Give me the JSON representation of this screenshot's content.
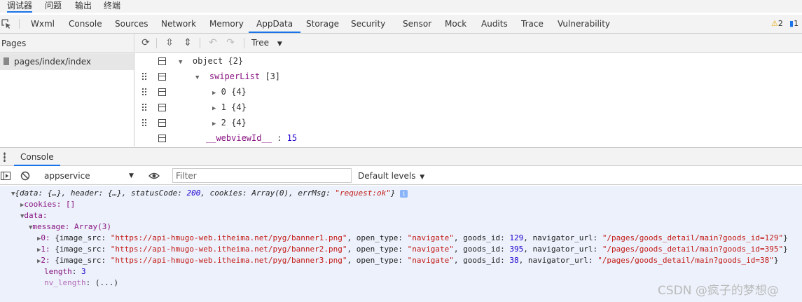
{
  "menubar": {
    "items": [
      {
        "label": "调试器",
        "active": true
      },
      {
        "label": "问题",
        "active": false
      },
      {
        "label": "输出",
        "active": false
      },
      {
        "label": "终端",
        "active": false
      }
    ]
  },
  "tabs": {
    "items": [
      "Wxml",
      "Console",
      "Sources",
      "Network",
      "Memory",
      "AppData",
      "Storage",
      "Security",
      "Sensor",
      "Mock",
      "Audits",
      "Trace",
      "Vulnerability"
    ],
    "active": "AppData",
    "warnings": "2",
    "infos": "1"
  },
  "pages": {
    "title": "Pages",
    "items": [
      "pages/index/index"
    ]
  },
  "appdata": {
    "view_mode": "Tree",
    "tree": [
      {
        "label": "object",
        "meta": "{2}"
      },
      {
        "label": "swiperList",
        "meta": "[3]"
      },
      {
        "label": "0",
        "meta": "{4}"
      },
      {
        "label": "1",
        "meta": "{4}"
      },
      {
        "label": "2",
        "meta": "{4}"
      },
      {
        "label": "__webviewId__",
        "meta": "15"
      }
    ]
  },
  "console": {
    "tab_label": "Console",
    "context": "appservice",
    "filter_placeholder": "Filter",
    "levels": "Default levels",
    "lines": {
      "l0a": "{data: {…}, header: {…}, statusCode: ",
      "l0b": "200",
      "l0c": ", cookies: Array(0), errMsg: ",
      "l0d": "\"request:ok\"",
      "l0e": "}",
      "l1": "cookies: []",
      "l2": "data:",
      "l3": "message: Array(3)",
      "m0_idx": "0:",
      "m0_a": " {image_src: ",
      "m0_src": "\"https://api-hmugo-web.itheima.net/pyg/banner1.png\"",
      "m0_b": ", open_type: ",
      "m0_type": "\"navigate\"",
      "m0_c": ", goods_id: ",
      "m0_id": "129",
      "m0_d": ", navigator_url: ",
      "m0_url": "\"/pages/goods_detail/main?goods_id=129\"",
      "m0_e": "}",
      "m1_idx": "1:",
      "m1_src": "\"https://api-hmugo-web.itheima.net/pyg/banner2.png\"",
      "m1_id": "395",
      "m1_url": "\"/pages/goods_detail/main?goods_id=395\"",
      "m2_idx": "2:",
      "m2_src": "\"https://api-hmugo-web.itheima.net/pyg/banner3.png\"",
      "m2_id": "38",
      "m2_url": "\"/pages/goods_detail/main?goods_id=38\"",
      "length_key": "length",
      "length_val": "3",
      "nv_key": "nv_length",
      "nv_val": "(...)"
    }
  },
  "watermark": "CSDN @疯子的梦想@"
}
